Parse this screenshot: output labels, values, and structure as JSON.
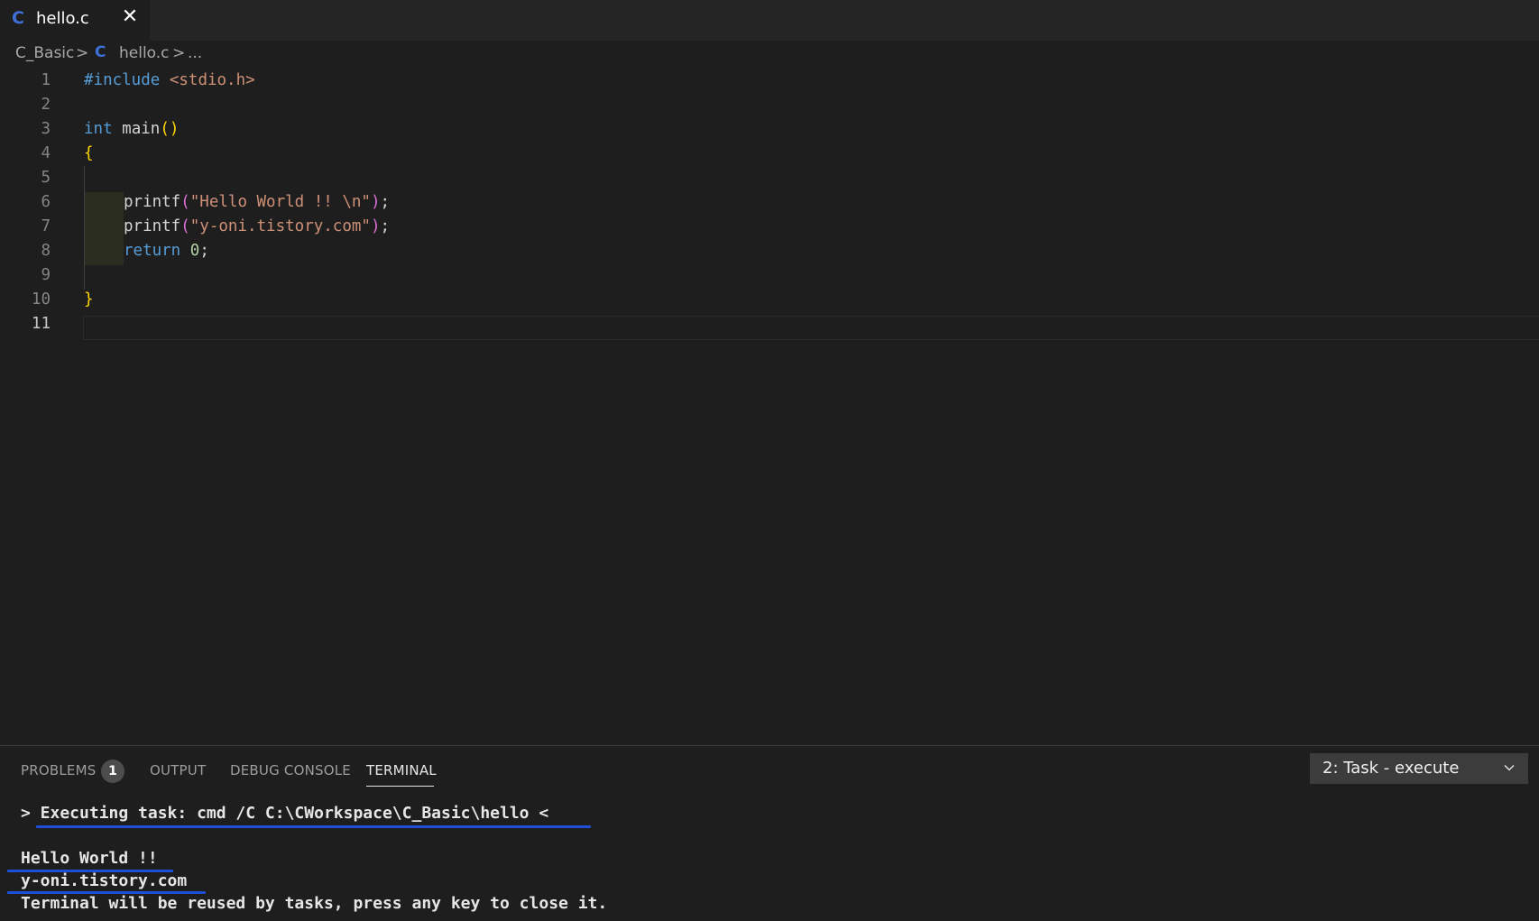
{
  "tab": {
    "icon": "C",
    "filename": "hello.c",
    "close_glyph": "✕"
  },
  "breadcrumb": {
    "folder": "C_Basic",
    "separator": ">",
    "file_icon": "C",
    "file": "hello.c",
    "ellipsis": "..."
  },
  "editor": {
    "line_numbers": [
      "1",
      "2",
      "3",
      "4",
      "5",
      "6",
      "7",
      "8",
      "9",
      "10",
      "11"
    ],
    "active_line": "11",
    "code": {
      "l1_directive": "#include",
      "l1_header": "<stdio.h>",
      "l3_type": "int",
      "l3_name": "main",
      "l3_parens": "()",
      "l4_brace": "{",
      "l6_fn": "printf",
      "l6_open": "(",
      "l6_str": "\"Hello World !! \\n\"",
      "l6_close": ")",
      "l6_semi": ";",
      "l7_fn": "printf",
      "l7_open": "(",
      "l7_str": "\"y-oni.tistory.com\"",
      "l7_close": ")",
      "l7_semi": ";",
      "l8_kw": "return",
      "l8_num": "0",
      "l8_semi": ";",
      "l10_brace": "}"
    }
  },
  "panel": {
    "tabs": {
      "problems": "PROBLEMS",
      "output": "OUTPUT",
      "debug_console": "DEBUG CONSOLE",
      "terminal": "TERMINAL"
    },
    "problems_count": "1",
    "terminal_selector": "2: Task - execute",
    "terminal_lines": {
      "executing": "> Executing task: cmd /C C:\\CWorkspace\\C_Basic\\hello <",
      "out1": "Hello World !!",
      "out2": "y-oni.tistory.com",
      "reuse": "Terminal will be reused by tasks, press any key to close it."
    }
  },
  "colors": {
    "accent_underline": "#1f4fd8",
    "c_icon": "#3f6fd8",
    "keyword": "#569cd6",
    "string": "#ce9178"
  }
}
